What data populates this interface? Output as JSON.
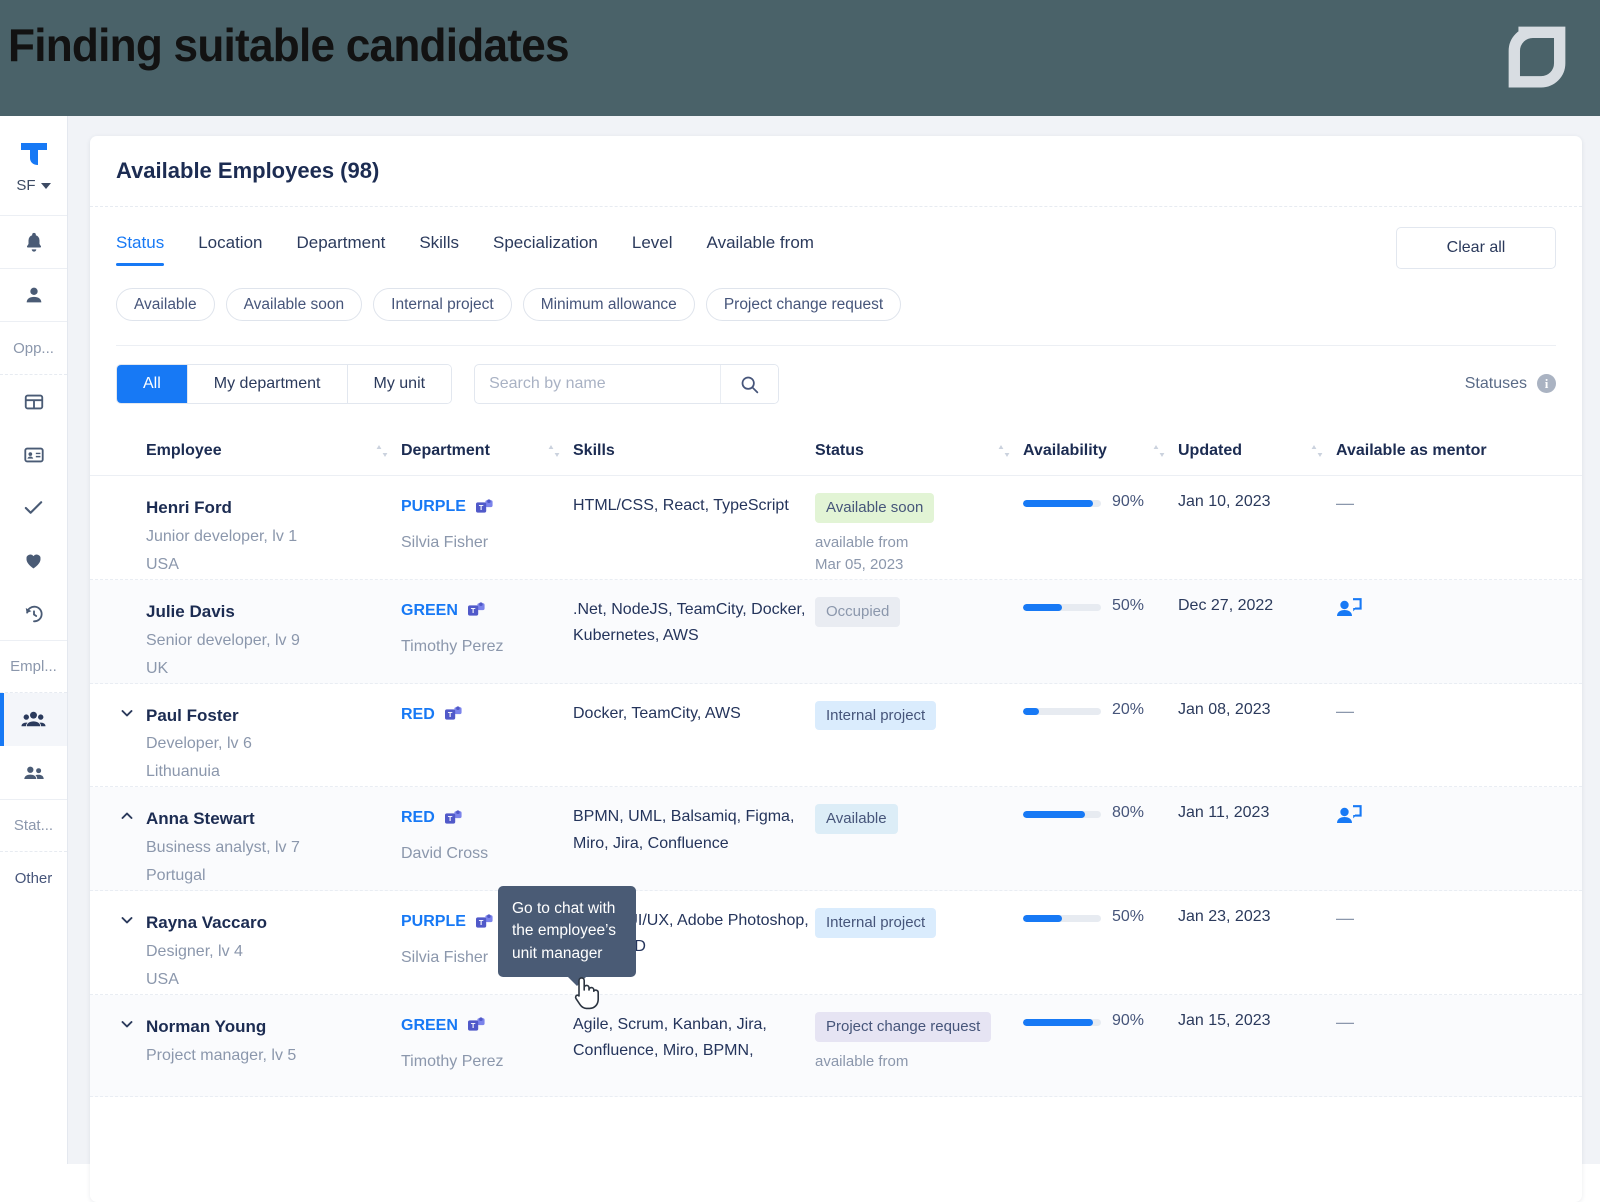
{
  "banner": {
    "title": "Finding suitable candidates",
    "logo_icon": "leaf-logo-icon",
    "bg_color": "#4a6269"
  },
  "sidebar": {
    "org_code": "SF",
    "logo_icon": "brand-t-logo-icon",
    "items": [
      {
        "name": "notifications",
        "icon": "bell-icon",
        "label": ""
      },
      {
        "name": "profile",
        "icon": "person-icon",
        "label": ""
      },
      {
        "name": "opportunities-section",
        "icon": "",
        "label": "Opp..."
      },
      {
        "name": "board",
        "icon": "grid-table-icon",
        "label": ""
      },
      {
        "name": "cards",
        "icon": "id-card-icon",
        "label": ""
      },
      {
        "name": "approvals",
        "icon": "check-icon",
        "label": ""
      },
      {
        "name": "favorites",
        "icon": "heart-icon",
        "label": ""
      },
      {
        "name": "history",
        "icon": "history-clock-icon",
        "label": ""
      },
      {
        "name": "employees-section",
        "icon": "",
        "label": "Empl..."
      },
      {
        "name": "available-employees",
        "icon": "people-group-icon",
        "label": ""
      },
      {
        "name": "teams",
        "icon": "people-two-icon",
        "label": ""
      },
      {
        "name": "statistics-section",
        "icon": "",
        "label": "Stat..."
      },
      {
        "name": "other-section",
        "icon": "",
        "label": "Other"
      }
    ]
  },
  "page": {
    "title": "Available Employees (98)",
    "clear_all_label": "Clear all",
    "statuses_label": "Statuses"
  },
  "filter_tabs": [
    {
      "label": "Status",
      "active": true
    },
    {
      "label": "Location",
      "active": false
    },
    {
      "label": "Department",
      "active": false
    },
    {
      "label": "Skills",
      "active": false
    },
    {
      "label": "Specialization",
      "active": false
    },
    {
      "label": "Level",
      "active": false
    },
    {
      "label": "Available from",
      "active": false
    }
  ],
  "chips": [
    "Available",
    "Available soon",
    "Internal project",
    "Minimum allowance",
    "Project change request"
  ],
  "scope_tabs": [
    {
      "label": "All",
      "active": true
    },
    {
      "label": "My department",
      "active": false
    },
    {
      "label": "My unit",
      "active": false
    }
  ],
  "search": {
    "placeholder": "Search by name",
    "value": "",
    "icon": "search-icon"
  },
  "table": {
    "columns": [
      {
        "label": "Employee",
        "sortable": true
      },
      {
        "label": "Department",
        "sortable": true
      },
      {
        "label": "Skills",
        "sortable": false
      },
      {
        "label": "Status",
        "sortable": true
      },
      {
        "label": "Availability",
        "sortable": true
      },
      {
        "label": "Updated",
        "sortable": true
      },
      {
        "label": "Available as mentor",
        "sortable": false
      }
    ],
    "rows": [
      {
        "expander": "",
        "name": "Henri Ford",
        "role": "Junior developer, lv 1",
        "country": "USA",
        "department": "PURPLE",
        "manager": "Silvia Fisher",
        "skills": "HTML/CSS, React, TypeScript",
        "status": "Available soon",
        "status_style": "b-green",
        "available_from": "available from Mar 05, 2023",
        "availability_pct": "90%",
        "availability_value": 90,
        "updated": "Jan 10, 2023",
        "mentor": "—"
      },
      {
        "expander": "",
        "name": "Julie Davis",
        "role": "Senior developer, lv 9",
        "country": "UK",
        "department": "GREEN",
        "manager": "Timothy Perez",
        "skills": ".Net, NodeJS, TeamCity, Docker, Kubernetes, AWS",
        "status": "Occupied",
        "status_style": "b-gray",
        "available_from": "",
        "availability_pct": "50%",
        "availability_value": 50,
        "updated": "Dec 27, 2022",
        "mentor": "mentor-icon"
      },
      {
        "expander": "down",
        "name": "Paul Foster",
        "role": "Developer, lv 6",
        "country": "Lithuanuia",
        "department": "RED",
        "manager": "",
        "skills": "Docker, TeamCity, AWS",
        "status": "Internal project",
        "status_style": "b-blue",
        "available_from": "",
        "availability_pct": "20%",
        "availability_value": 20,
        "updated": "Jan 08, 2023",
        "mentor": "—"
      },
      {
        "expander": "up",
        "name": "Anna Stewart",
        "role": "Business analyst, lv 7",
        "country": "Portugal",
        "department": "RED",
        "manager": "David Cross",
        "skills": "BPMN, UML, Balsamiq, Figma, Miro, Jira, Confluence",
        "status": "Available",
        "status_style": "b-cyan",
        "available_from": "",
        "availability_pct": "80%",
        "availability_value": 80,
        "updated": "Jan 11, 2023",
        "mentor": "mentor-icon"
      },
      {
        "expander": "down",
        "name": "Rayna Vaccaro",
        "role": "Designer, lv 4",
        "country": "USA",
        "department": "PURPLE",
        "manager": "Silvia Fisher",
        "skills": "Figma, UI/UX, Adobe Photoshop, Adobe XD",
        "status": "Internal project",
        "status_style": "b-blue",
        "available_from": "",
        "availability_pct": "50%",
        "availability_value": 50,
        "updated": "Jan 23, 2023",
        "mentor": "—"
      },
      {
        "expander": "down",
        "name": "Norman Young",
        "role": "Project manager, lv 5",
        "country": "",
        "department": "GREEN",
        "manager": "Timothy Perez",
        "skills": "Agile, Scrum, Kanban, Jira, Confluence, Miro, BPMN,",
        "status": "Project change request",
        "status_style": "b-purple",
        "available_from": "available from",
        "availability_pct": "90%",
        "availability_value": 90,
        "updated": "Jan 15, 2023",
        "mentor": "—"
      }
    ]
  },
  "tooltip": {
    "text": "Go to chat with the employee’s unit manager"
  },
  "colors": {
    "accent": "#1779f5",
    "banner": "#4a6269",
    "title": "#1c2c52",
    "tooltip_bg": "#4a5b75"
  }
}
